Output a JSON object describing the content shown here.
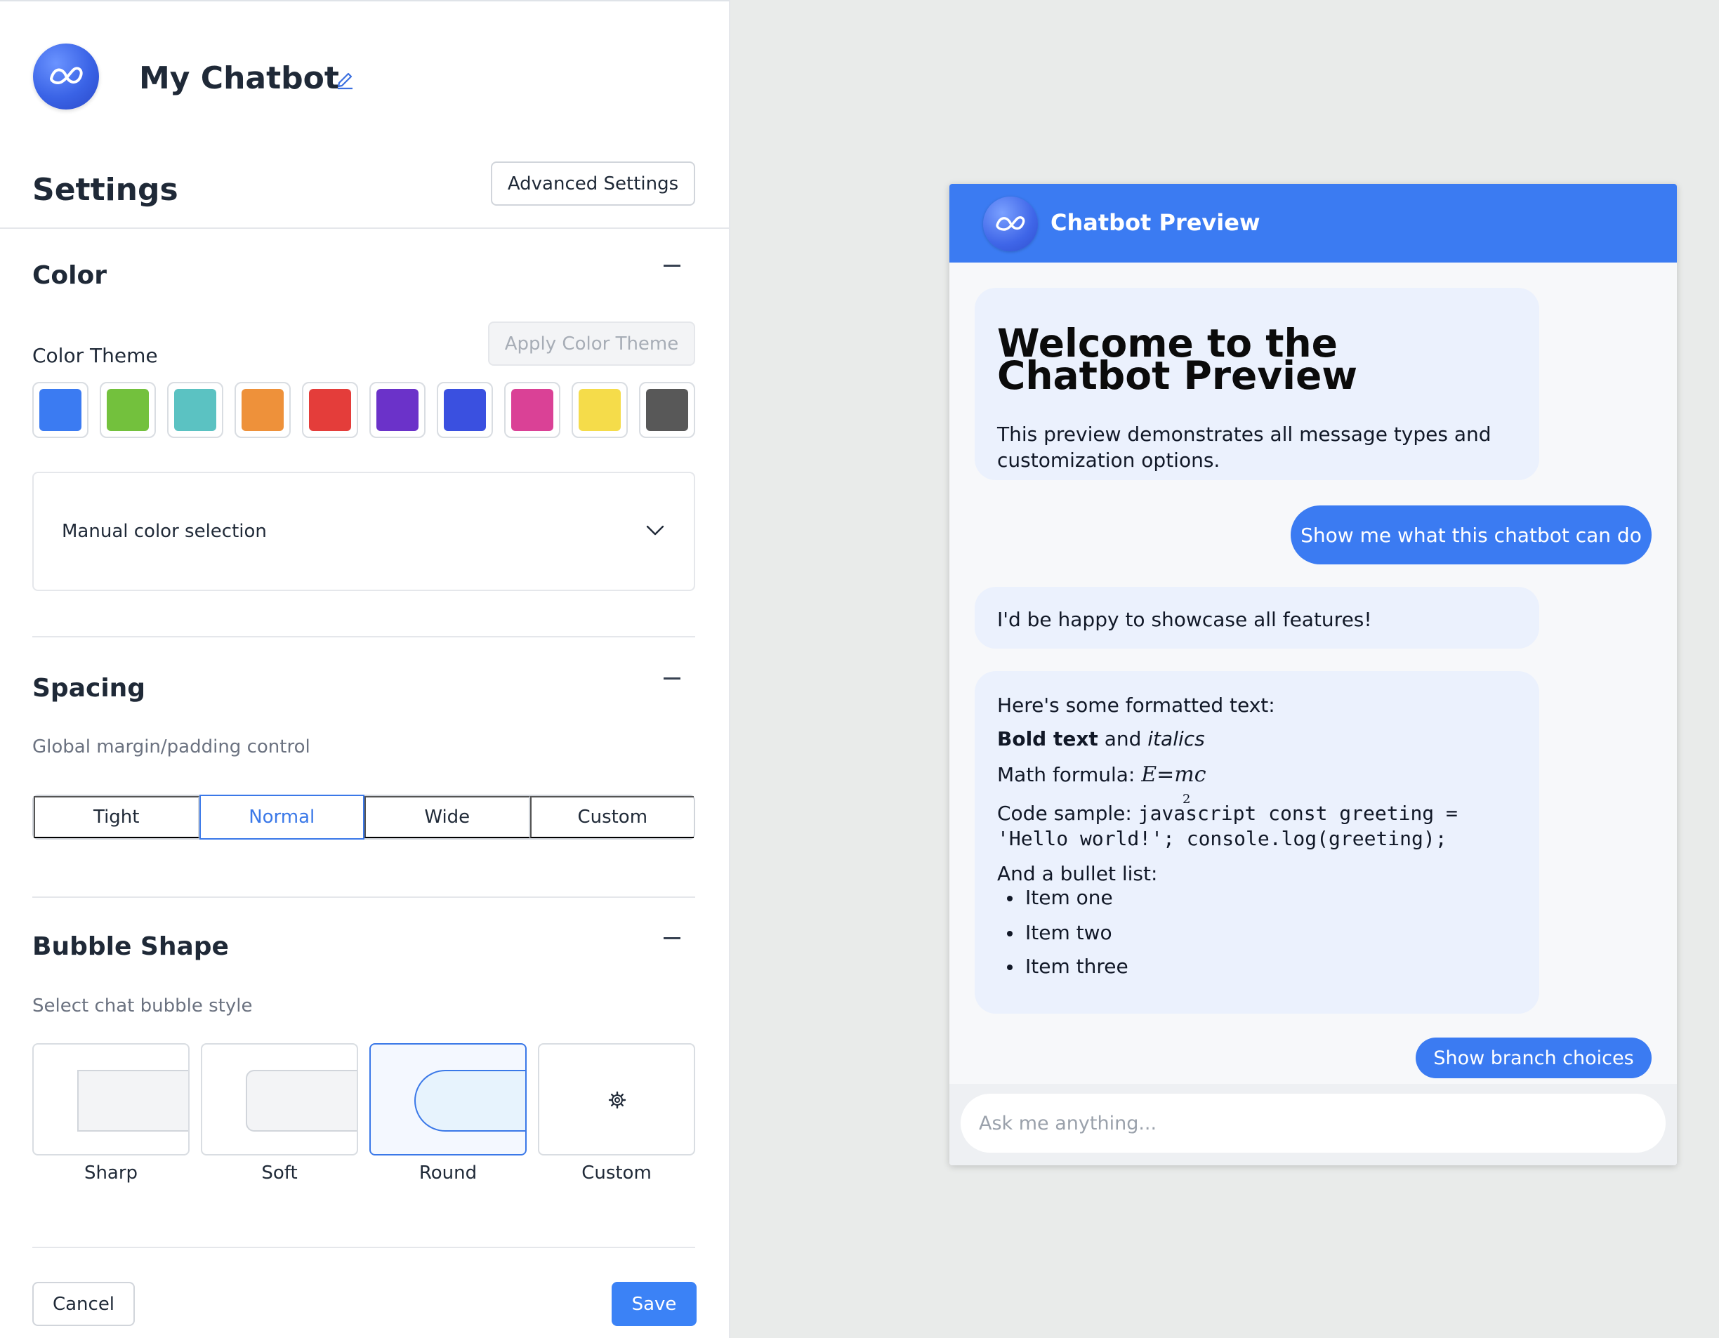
{
  "app": {
    "bot_name": "My Chatbot",
    "brand_icon": "infinity-wave-icon",
    "edit_icon": "pencil-icon"
  },
  "header": {
    "title": "Settings",
    "advanced_label": "Advanced Settings"
  },
  "color": {
    "title": "Color",
    "theme_label": "Color Theme",
    "apply_label": "Apply Color Theme",
    "swatches": [
      "#3b7bf2",
      "#73c13d",
      "#5bc2c2",
      "#ee913a",
      "#e43d3a",
      "#6b32c9",
      "#3a50e0",
      "#da4196",
      "#f5dc4a",
      "#585858"
    ],
    "manual_label": "Manual color selection"
  },
  "spacing": {
    "title": "Spacing",
    "description": "Global margin/padding control",
    "options": [
      "Tight",
      "Normal",
      "Wide",
      "Custom"
    ],
    "selected": "Normal"
  },
  "bubble_shape": {
    "title": "Bubble Shape",
    "description": "Select chat bubble style",
    "options": [
      "Sharp",
      "Soft",
      "Round",
      "Custom"
    ],
    "selected": "Round"
  },
  "footer": {
    "cancel_label": "Cancel",
    "save_label": "Save",
    "accent": "#3b82f6"
  },
  "preview": {
    "title": "Chatbot Preview",
    "header_color": "#3b7bf2",
    "bubble_color": "#ebf1fd",
    "welcome_title": "Welcome to the Chatbot Preview",
    "welcome_text": "This preview demonstrates all message types and customization options.",
    "user_message_1": "Show me what this chatbot can do",
    "bot_message_1": "I'd be happy to showcase all features!",
    "formatted": {
      "intro": "Here's some formatted text:",
      "bold": "Bold text",
      "and": " and ",
      "italic": "italics",
      "math_label": "Math formula: ",
      "math_formula": "E=mc",
      "math_exponent": "2",
      "code_label": "Code sample: ",
      "code_line_1": "javascript const greeting =",
      "code_line_2": "'Hello world!'; console.log(greeting);",
      "list_intro": "And a bullet list:",
      "list_items": [
        "Item one",
        "Item two",
        "Item three"
      ]
    },
    "user_message_2": "Show branch choices",
    "input_placeholder": "Ask me anything..."
  }
}
